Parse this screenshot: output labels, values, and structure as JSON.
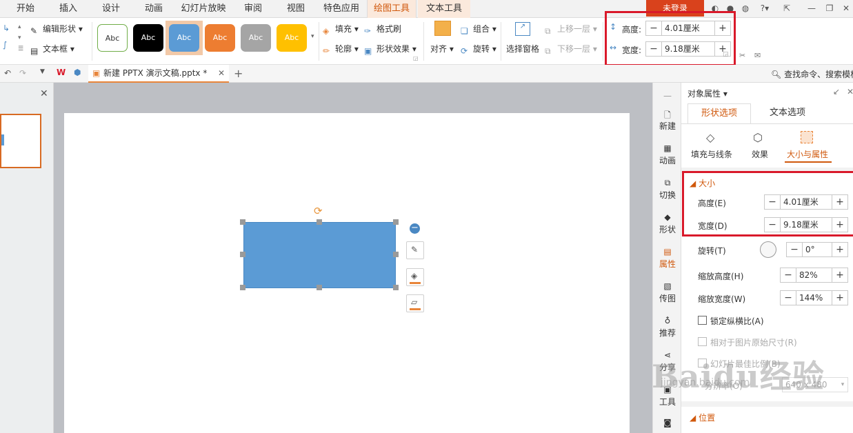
{
  "menu": {
    "items": [
      "开始",
      "插入",
      "设计",
      "动画",
      "幻灯片放映",
      "审阅",
      "视图",
      "特色应用",
      "绘图工具",
      "文本工具"
    ],
    "active": "绘图工具",
    "login": "未登录"
  },
  "ribbon": {
    "edit_shape": "编辑形状",
    "textbox": "文本框",
    "style_swatch_text": "Abc",
    "fill": "填充",
    "format_painter": "格式刷",
    "outline": "轮廓",
    "shape_effects": "形状效果",
    "align": "对齐",
    "group": "组合",
    "rotate": "旋转",
    "selection_pane": "选择窗格",
    "bring_forward": "上移一层",
    "send_backward": "下移一层",
    "height_label": "高度:",
    "height_value": "4.01厘米",
    "width_label": "宽度:",
    "width_value": "9.18厘米",
    "colors": {
      "accent": "#d0580c",
      "red_box": "#d9192a"
    }
  },
  "tabbar": {
    "doc_title": "新建 PPTX 演示文稿.pptx *",
    "new_tab": "+",
    "search": "查找命令、搜索模板"
  },
  "sidebar": {
    "items": [
      "新建",
      "动画",
      "切换",
      "形状",
      "属性",
      "传图",
      "推荐",
      "分享",
      "工具"
    ]
  },
  "props": {
    "title": "对象属性",
    "tabs": [
      "形状选项",
      "文本选项"
    ],
    "subtabs": [
      "填充与线条",
      "效果",
      "大小与属性"
    ],
    "section_size": "大小",
    "height_label": "高度(E)",
    "height_value": "4.01厘米",
    "width_label": "宽度(D)",
    "width_value": "9.18厘米",
    "rotation_label": "旋转(T)",
    "rotation_value": "0°",
    "scale_h_label": "缩放高度(H)",
    "scale_h_value": "82%",
    "scale_w_label": "缩放宽度(W)",
    "scale_w_value": "144%",
    "lock_ratio": "锁定纵横比(A)",
    "relative_orig": "相对于图片原始尺寸(R)",
    "slide_ratio": "幻灯片最佳比例(B)",
    "resolution_label": "分辨率(O)",
    "resolution_value": "640 x 480",
    "section_position": "位置"
  },
  "watermark": {
    "brand": "Baidu经验",
    "url": "jingyan.baidu.com"
  }
}
